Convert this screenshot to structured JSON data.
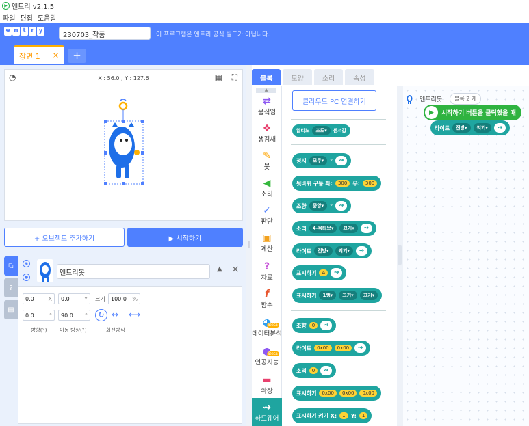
{
  "window": {
    "title": "엔트리 v2.1.5"
  },
  "menu": [
    "파일",
    "편집",
    "도움말"
  ],
  "header": {
    "brand_letters": [
      "e",
      "n",
      "t",
      "r",
      "y"
    ],
    "project_name": "230703_작품",
    "notice": "이 프로그램은 엔트리 공식 빌드가 아닙니다."
  },
  "scene": {
    "tab_label": "장면 1",
    "close": "×",
    "add": "+"
  },
  "stage": {
    "coords": "X : 56.0 , Y : 127.6"
  },
  "buttons": {
    "add_object": "+ 오브젝트 추가하기",
    "start": "▶ 시작하기"
  },
  "object": {
    "name": "엔트리봇",
    "x": "0.0",
    "x_unit": "X",
    "y": "0.0",
    "y_unit": "Y",
    "size_label": "크기",
    "size": "100.0",
    "size_unit": "%",
    "direction": "0.0",
    "direction_unit": "°",
    "move_direction": "90.0",
    "move_direction_unit": "°",
    "direction_label": "방향(°)",
    "move_direction_label": "이동 방향(°)",
    "rotation_label": "회전방식"
  },
  "tabs": [
    "블록",
    "모양",
    "소리",
    "속성"
  ],
  "categories": [
    "움직임",
    "생김새",
    "붓",
    "소리",
    "판단",
    "계산",
    "자료",
    "함수",
    "데이터분석",
    "인공지능",
    "확장",
    "하드웨어"
  ],
  "beta": "Beta",
  "palette": {
    "connect_button": "클라우드 PC 연결하기",
    "blocks": [
      {
        "parts": [
          "알티노",
          "조도▾",
          "센서값"
        ]
      },
      {
        "parts": [
          "정지",
          "모두▾",
          "°"
        ]
      },
      {
        "parts": [
          "뒷바퀴 구동 좌:",
          "300",
          "우:",
          "300"
        ]
      },
      {
        "parts": [
          "조향",
          "중앙▾",
          "°"
        ]
      },
      {
        "parts": [
          "소리",
          "4-옥타브▾",
          "끄기▾"
        ]
      },
      {
        "parts": [
          "라이트",
          "전방▾",
          "켜기▾"
        ]
      },
      {
        "parts": [
          "표시하기",
          "A"
        ]
      },
      {
        "parts": [
          "표시하기",
          "1행▾",
          "끄기▾",
          "끄기▾"
        ]
      },
      {
        "parts": [
          "조향",
          "0"
        ]
      },
      {
        "parts": [
          "라이트",
          "0x00",
          "0x00"
        ]
      },
      {
        "parts": [
          "소리",
          "0"
        ]
      },
      {
        "parts": [
          "표시하기",
          "0x00",
          "0x00",
          "0x00"
        ]
      },
      {
        "parts": [
          "표시하기 켜기 X:",
          "1",
          "Y:",
          "1"
        ]
      }
    ]
  },
  "workspace": {
    "object_name": "엔트리봇",
    "block_count": "블록 2 개",
    "event_block": "시작하기 버튼을 클릭했을 때",
    "light_block": [
      "라이트",
      "전방▾",
      "켜기▾"
    ]
  },
  "colors": {
    "accent": "#4f80ff",
    "hardware": "#1fa5a0",
    "tab_active": "#ffb000"
  }
}
